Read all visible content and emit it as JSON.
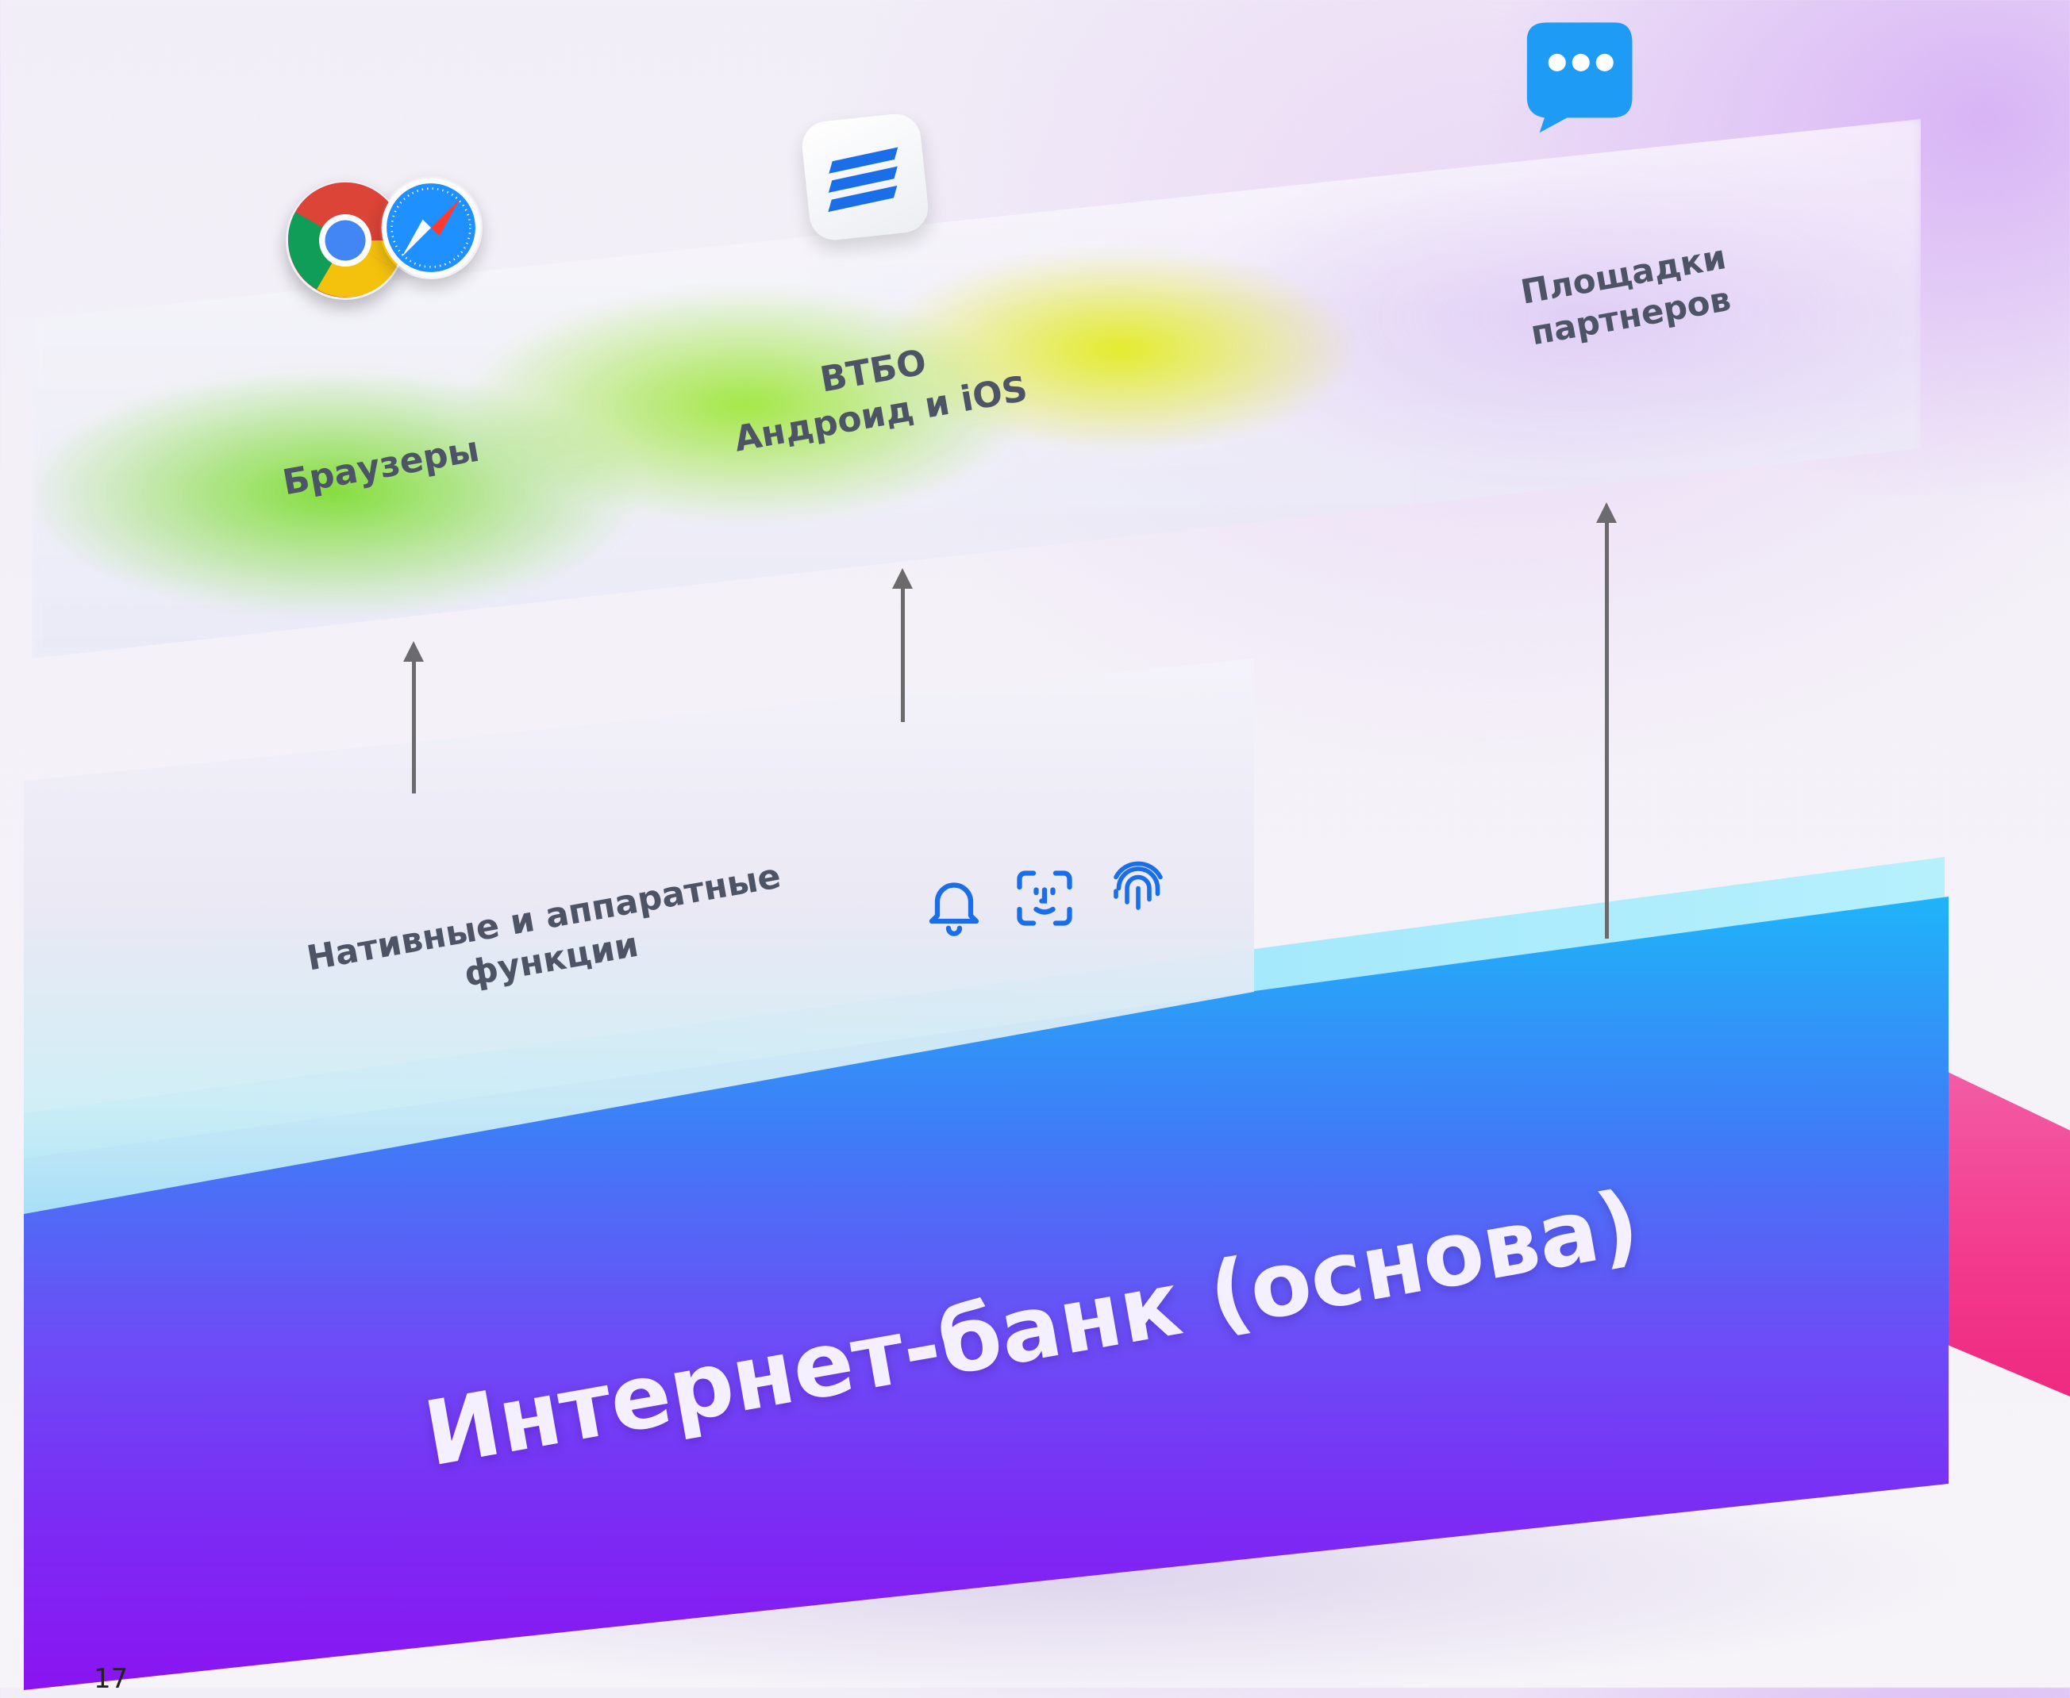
{
  "diagram": {
    "top_platform": {
      "browsers_label": "Браузеры",
      "vtbo_label_line1": "ВТБО",
      "vtbo_label_line2": "Андроид и iOS",
      "partners_label_line1": "Площадки",
      "partners_label_line2": "партнеров"
    },
    "middle_platform": {
      "label_line1": "Нативные и аппаратные",
      "label_line2": "функции",
      "icons": [
        "bell-icon",
        "face-id-icon",
        "fingerprint-icon"
      ]
    },
    "base_platform": {
      "label": "Интернет-банк (основа)"
    },
    "top_icons": [
      "chrome-icon",
      "safari-icon",
      "vtbo-app-icon",
      "chat-icon"
    ],
    "page_number": "17"
  },
  "colors": {
    "text": "#4d5466",
    "arrow": "#6b6b6e",
    "base_top": "#1fb4f9",
    "base_bottom": "#8a14f1",
    "accent_green": "#78dc28",
    "accent_yellow": "#e2ec14",
    "side_pink": "#f33a8c",
    "icon_blue": "#1a6fe8"
  }
}
